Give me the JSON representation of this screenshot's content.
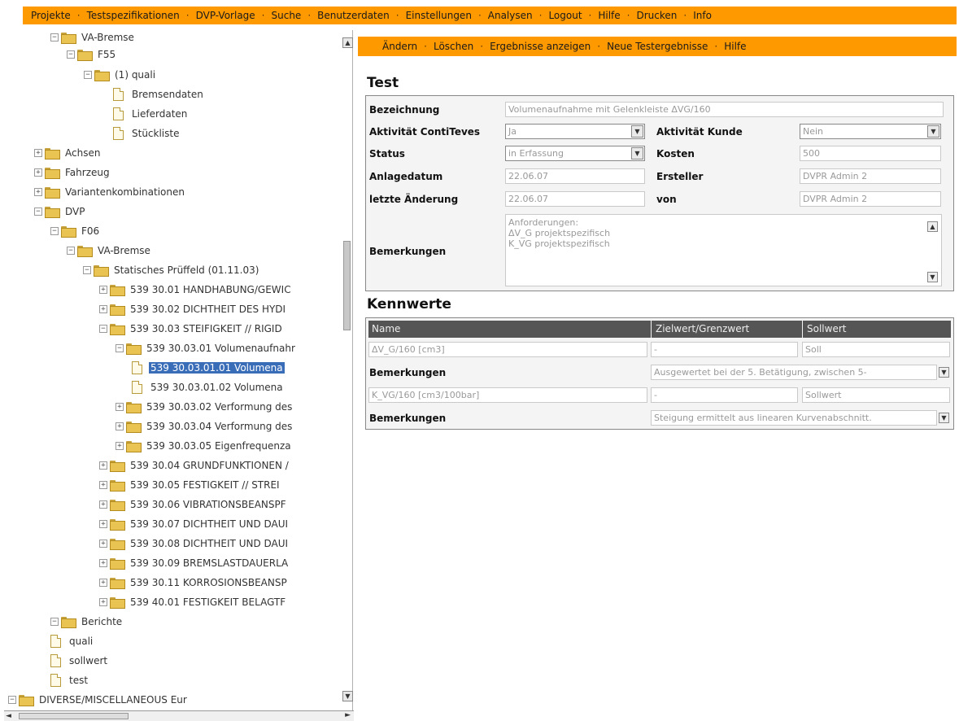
{
  "top_menu": [
    "Projekte",
    "Testspezifikationen",
    "DVP-Vorlage",
    "Suche",
    "Benutzerdaten",
    "Einstellungen",
    "Analysen",
    "Logout",
    "Hilfe",
    "Drucken",
    "Info"
  ],
  "menu_separator": "·",
  "tree": {
    "collapse_glyph": "−",
    "expand_glyph": "+",
    "nodes": [
      {
        "label": "VA-Bremse",
        "type": "folder",
        "toggle": "minus"
      },
      {
        "label": "F55",
        "type": "folder",
        "toggle": "minus"
      },
      {
        "label": "(1) quali",
        "type": "folder",
        "toggle": "minus"
      },
      {
        "label": "Bremsendaten",
        "type": "doc"
      },
      {
        "label": "Lieferdaten",
        "type": "doc"
      },
      {
        "label": "Stückliste",
        "type": "doc"
      },
      {
        "label": "Achsen",
        "type": "folder",
        "toggle": "plus"
      },
      {
        "label": "Fahrzeug",
        "type": "folder",
        "toggle": "plus"
      },
      {
        "label": "Variantenkombinationen",
        "type": "folder",
        "toggle": "plus"
      },
      {
        "label": "DVP",
        "type": "folder",
        "toggle": "minus"
      },
      {
        "label": "F06",
        "type": "folder",
        "toggle": "minus"
      },
      {
        "label": "VA-Bremse",
        "type": "folder",
        "toggle": "minus"
      },
      {
        "label": "Statisches Prüffeld (01.11.03)",
        "type": "folder",
        "toggle": "minus"
      },
      {
        "label": "539 30.01 HANDHABUNG/GEWIC",
        "type": "folder",
        "toggle": "plus"
      },
      {
        "label": "539 30.02 DICHTHEIT DES HYDI",
        "type": "folder",
        "toggle": "plus"
      },
      {
        "label": "539 30.03 STEIFIGKEIT // RIGID",
        "type": "folder",
        "toggle": "minus"
      },
      {
        "label": "539 30.03.01 Volumenaufnahr",
        "type": "folder",
        "toggle": "minus"
      },
      {
        "label": "539 30.03.01.01 Volumena",
        "type": "doc",
        "selected": true
      },
      {
        "label": "539 30.03.01.02 Volumena",
        "type": "doc"
      },
      {
        "label": "539 30.03.02 Verformung des",
        "type": "folder",
        "toggle": "plus"
      },
      {
        "label": "539 30.03.04 Verformung des",
        "type": "folder",
        "toggle": "plus"
      },
      {
        "label": "539 30.03.05 Eigenfrequenza",
        "type": "folder",
        "toggle": "plus"
      },
      {
        "label": "539 30.04 GRUNDFUNKTIONEN /",
        "type": "folder",
        "toggle": "plus"
      },
      {
        "label": "539 30.05 FESTIGKEIT // STREI",
        "type": "folder",
        "toggle": "plus"
      },
      {
        "label": "539 30.06 VIBRATIONSBEANSPF",
        "type": "folder",
        "toggle": "plus"
      },
      {
        "label": "539 30.07 DICHTHEIT UND DAUI",
        "type": "folder",
        "toggle": "plus"
      },
      {
        "label": "539 30.08 DICHTHEIT UND DAUI",
        "type": "folder",
        "toggle": "plus"
      },
      {
        "label": "539 30.09 BREMSLASTDAUERLA",
        "type": "folder",
        "toggle": "plus"
      },
      {
        "label": "539 30.11 KORROSIONSBEANSP",
        "type": "folder",
        "toggle": "plus"
      },
      {
        "label": "539 40.01 FESTIGKEIT BELAGTF",
        "type": "folder",
        "toggle": "plus"
      },
      {
        "label": "Berichte",
        "type": "folder",
        "toggle": "minus"
      },
      {
        "label": "quali",
        "type": "doc"
      },
      {
        "label": "sollwert",
        "type": "doc"
      },
      {
        "label": "test",
        "type": "doc"
      },
      {
        "label": "DIVERSE/MISCELLANEOUS Eur",
        "type": "folder",
        "toggle": "minus"
      }
    ]
  },
  "sub_menu": [
    "Ändern",
    "Löschen",
    "Ergebnisse anzeigen",
    "Neue Testergebnisse",
    "Hilfe"
  ],
  "scroll_glyphs": {
    "up": "▲",
    "down": "▼",
    "left": "◄",
    "right": "►",
    "select": "▼"
  },
  "test": {
    "title": "Test",
    "bezeichnung_label": "Bezeichnung",
    "bezeichnung_value": "Volumenaufnahme mit Gelenkleiste ΔVG/160",
    "aktivitaet_conti_label": "Aktivität ContiTeves",
    "aktivitaet_conti_value": "Ja",
    "aktivitaet_kunde_label": "Aktivität Kunde",
    "aktivitaet_kunde_value": "Nein",
    "status_label": "Status",
    "status_value": "in Erfassung",
    "kosten_label": "Kosten",
    "kosten_value": "500",
    "anlagedatum_label": "Anlagedatum",
    "anlagedatum_value": "22.06.07",
    "ersteller_label": "Ersteller",
    "ersteller_value": "DVPR Admin 2",
    "letzte_aenderung_label": "letzte Änderung",
    "letzte_aenderung_value": "22.06.07",
    "von_label": "von",
    "von_value": "DVPR Admin 2",
    "bemerkungen_label": "Bemerkungen",
    "bemerkungen_value": "Anforderungen:\nΔV_G projektspezifisch\nK_VG projektspezifisch"
  },
  "kennwerte": {
    "title": "Kennwerte",
    "headers": [
      "Name",
      "Zielwert/Grenzwert",
      "Sollwert"
    ],
    "rows": [
      {
        "name": "ΔV_G/160 [cm3]",
        "zielwert": "-",
        "sollwert": "Soll",
        "remarks_label": "Bemerkungen",
        "remarks": "Ausgewertet bei der 5. Betätigung, zwischen 5-"
      },
      {
        "name": "K_VG/160 [cm3/100bar]",
        "zielwert": "-",
        "sollwert": "Sollwert",
        "remarks_label": "Bemerkungen",
        "remarks": "Steigung ermittelt aus linearen Kurvenabschnitt."
      }
    ]
  }
}
